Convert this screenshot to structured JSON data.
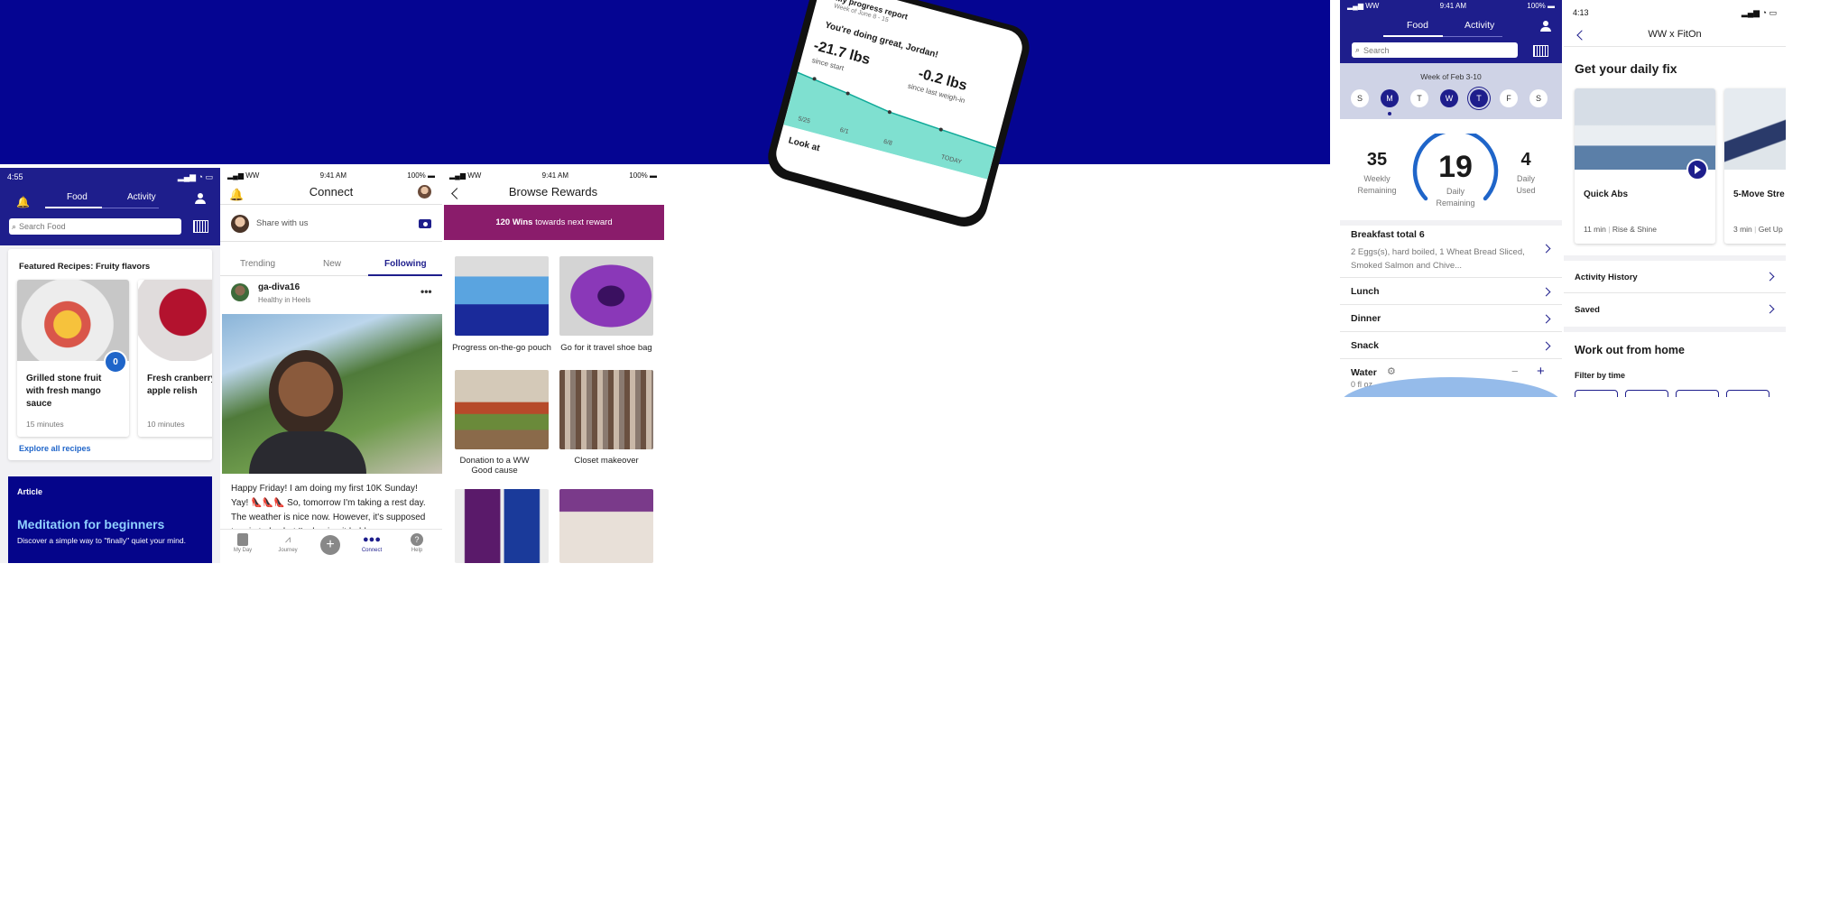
{
  "phone_hero": {
    "title": "My progress report",
    "subtitle": "Week of June 8 - 15",
    "headline": "You're doing great, Jordan!",
    "stat1_value": "-21.7 lbs",
    "stat1_label": "since start",
    "stat2_value": "-0.2 lbs",
    "stat2_label": "since last weigh-in",
    "axis": [
      "5/25",
      "6/1",
      "6/8",
      "TODAY"
    ],
    "footer": "Look at"
  },
  "screen1": {
    "status_time": "4:55",
    "tabs": [
      "Food",
      "Activity"
    ],
    "search_placeholder": "Search Food",
    "featured_title": "Featured Recipes: Fruity flavors",
    "recipes": [
      {
        "title": "Grilled stone fruit with fresh mango sauce",
        "time": "15 minutes",
        "points": "0"
      },
      {
        "title": "Fresh cranberry apple relish",
        "time": "10 minutes"
      }
    ],
    "explore_link": "Explore all recipes",
    "article_label": "Article",
    "article_title": "Meditation for beginners",
    "article_desc": "Discover a simple way to \"finally\" quiet your mind."
  },
  "screen2": {
    "status_carrier": "WW",
    "status_time": "9:41 AM",
    "status_battery": "100%",
    "title": "Connect",
    "share_placeholder": "Share with us",
    "tabs": [
      "Trending",
      "New",
      "Following"
    ],
    "username": "ga-diva16",
    "user_tag": "Healthy in Heels",
    "post_text": "Happy Friday! I am doing my first 10K Sunday! Yay! 👠👠👠 So, tomorrow I'm taking a rest day. The weather is nice now. However, it's supposed to rain today but I'm hoping it holds",
    "bottom_nav": [
      "My Day",
      "Journey",
      "",
      "Connect",
      "Help"
    ]
  },
  "screen3": {
    "status_carrier": "WW",
    "status_time": "9:41 AM",
    "status_battery": "100%",
    "title": "Browse Rewards",
    "wins_bold": "120 Wins",
    "wins_rest": " towards next reward",
    "items": [
      "Progress on-the-go pouch",
      "Go for it travel shoe bag",
      "Donation to a WW Good cause",
      "Closet makeover",
      "",
      ""
    ]
  },
  "screen4": {
    "status_carrier": "WW",
    "status_time": "9:41 AM",
    "status_battery": "100%",
    "tabs": [
      "Food",
      "Activity"
    ],
    "search_placeholder": "Search",
    "week_label": "Week of Feb 3-10",
    "days": [
      "S",
      "M",
      "T",
      "W",
      "T",
      "F",
      "S"
    ],
    "weekly_value": "35",
    "weekly_label": "Weekly Remaining",
    "daily_value": "19",
    "daily_label": "Daily Remaining",
    "used_value": "4",
    "used_label": "Daily Used",
    "breakfast_title": "Breakfast total 6",
    "breakfast_desc": "2 Eggs(s), hard boiled, 1 Wheat Bread Sliced, Smoked Salmon and Chive...",
    "meals": [
      "Lunch",
      "Dinner",
      "Snack"
    ],
    "water_label": "Water",
    "water_value": "0 fl oz"
  },
  "screen5": {
    "status_time": "4:13",
    "title": "WW x FitOn",
    "daily_fix": "Get your daily fix",
    "workouts": [
      {
        "title": "Quick Abs",
        "duration": "11 min",
        "category": "Rise & Shine"
      },
      {
        "title": "5-Move Stre",
        "duration": "3 min",
        "category": "Get Up"
      }
    ],
    "links": [
      "Activity History",
      "Saved"
    ],
    "workout_home": "Work out from home",
    "filter_label": "Filter by time"
  },
  "colors": {
    "navy": "#1e1e8c",
    "banner": "#050592",
    "purple": "#8a1c6b",
    "teal": "#7fe0d0"
  }
}
